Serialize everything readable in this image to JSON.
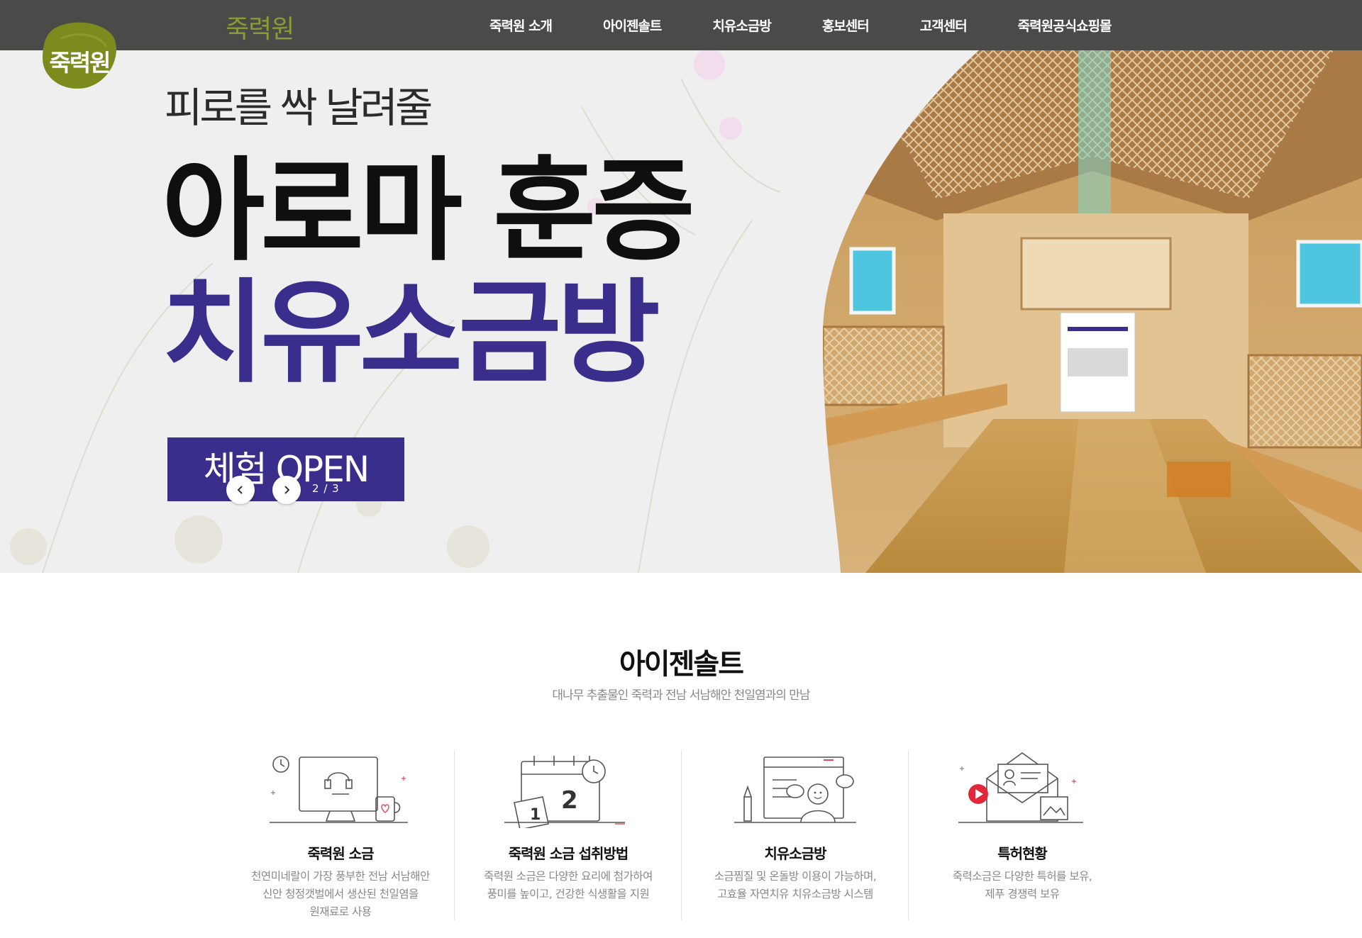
{
  "header": {
    "logo_badge_text": "죽력원",
    "logo_wordmark": "죽력원",
    "brand_color": "#8a9a34",
    "nav": [
      {
        "label": "죽력원 소개"
      },
      {
        "label": "아이젠솔트"
      },
      {
        "label": "치유소금방"
      },
      {
        "label": "홍보센터"
      },
      {
        "label": "고객센터"
      },
      {
        "label": "죽력원공식쇼핑몰"
      }
    ]
  },
  "hero": {
    "subtitle": "피로를 싹 날려줄",
    "title_line1": "아로마 훈증",
    "title_line2": "치유소금방",
    "cta_label": "체험 OPEN",
    "accent_color": "#3a2e8c",
    "slider": {
      "current": "2",
      "separator": "/",
      "total": "3",
      "prev_icon": "chevron-left-icon",
      "next_icon": "chevron-right-icon"
    }
  },
  "section": {
    "title": "아이젠솔트",
    "subtitle": "대나무 추출물인 죽력과 전남 서남해안 천일염과의 만남"
  },
  "features": [
    {
      "icon": "desktop-support-icon",
      "title": "죽력원 소금",
      "desc": [
        "천연미네랄이 가장 풍부한 전남 서남해안",
        "신안 청정갯벌에서 생산된 천일염을",
        "원재료로 사용"
      ]
    },
    {
      "icon": "calendar-icon",
      "title": "죽력원 소금 섭취방법",
      "desc": [
        "죽력원 소금은 다양한 요리에 첨가하여",
        "풍미를 높이고, 건강한 식생활을 지원"
      ]
    },
    {
      "icon": "chat-browser-icon",
      "title": "치유소금방",
      "desc": [
        "소금찜질 및 온돌방 이용이 가능하며,",
        "고효율 자연치유 치유소금방 시스템"
      ]
    },
    {
      "icon": "media-mail-icon",
      "title": "특허현황",
      "desc": [
        "죽력소금은 다양한 특허를 보유,",
        "제푸 경쟁력 보유"
      ]
    }
  ]
}
